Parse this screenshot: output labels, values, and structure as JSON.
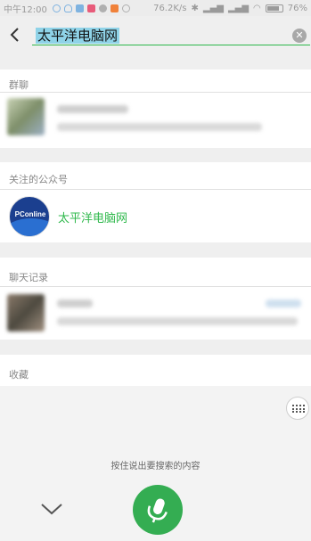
{
  "status_bar": {
    "time": "中午12:00",
    "network_speed": "76.2K/s",
    "battery": "76%"
  },
  "search": {
    "query": "太平洋电脑网",
    "back_icon": "chevron-left-icon",
    "clear_icon": "clear-circle-icon"
  },
  "sections": {
    "group_chats": {
      "title": "群聊"
    },
    "official_accounts": {
      "title": "关注的公众号",
      "items": [
        {
          "name": "太平洋电脑网",
          "avatar_text": "PConline"
        }
      ]
    },
    "chat_history": {
      "title": "聊天记录"
    },
    "favorites": {
      "title": "收藏"
    }
  },
  "voice": {
    "hint": "按住说出要搜索的内容",
    "accent_color": "#34ad52"
  },
  "colors": {
    "accent_green": "#2eb84b",
    "highlight": "#8fd3e8"
  }
}
